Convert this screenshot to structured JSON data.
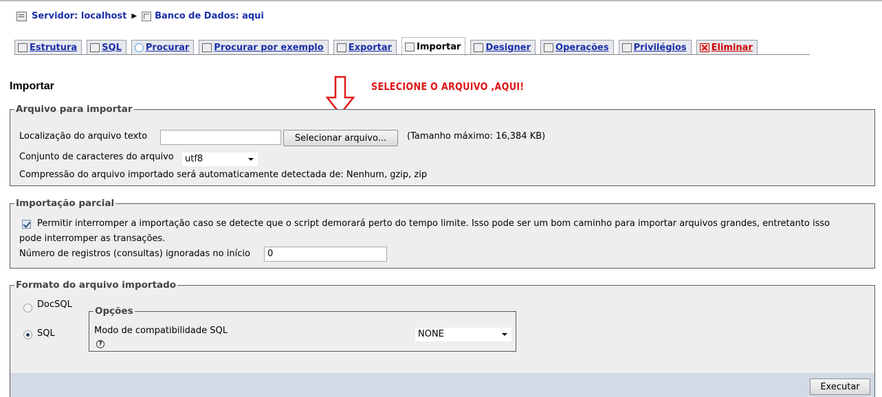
{
  "breadcrumb": {
    "server": "Servidor: localhost",
    "database": "Banco de Dados: aqui"
  },
  "tabs": [
    {
      "label": "Estrutura",
      "icon": "structure-icon"
    },
    {
      "label": "SQL",
      "icon": "sql-icon"
    },
    {
      "label": "Procurar",
      "icon": "search-icon"
    },
    {
      "label": "Procurar por exemplo",
      "icon": "query-icon"
    },
    {
      "label": "Exportar",
      "icon": "export-icon"
    },
    {
      "label": "Importar",
      "icon": "import-icon"
    },
    {
      "label": "Designer",
      "icon": "designer-icon"
    },
    {
      "label": "Operações",
      "icon": "operations-icon"
    },
    {
      "label": "Privilégios",
      "icon": "privileges-icon"
    },
    {
      "label": "Eliminar",
      "icon": "delete-icon"
    }
  ],
  "page_title": "Importar",
  "annotation": "SELECIONE O ARQUIVO ,AQUI!",
  "file_section": {
    "legend": "Arquivo para importar",
    "location_label": "Localização do arquivo texto",
    "file_value": "",
    "choose_button": "Selecionar arquivo...",
    "max_size": "(Tamanho máximo: 16,384 KB)",
    "charset_label": "Conjunto de caracteres do arquivo",
    "charset_value": "utf8",
    "compression_text": "Compressão do arquivo importado será automaticamente detectada de: Nenhum, gzip, zip"
  },
  "partial_section": {
    "legend": "Importação parcial",
    "allow_interrupt_line1": "Permitir interromper a importação caso se detecte que o script demorará perto do tempo limite. Isso pode ser um bom caminho para importar arquivos grandes, entretanto isso",
    "allow_interrupt_line2": "pode interromper as transações.",
    "allow_interrupt_checked": true,
    "skip_label": "Número de registros (consultas) ignoradas no início",
    "skip_value": "0"
  },
  "format_section": {
    "legend": "Formato do arquivo importado",
    "formats": [
      {
        "label": "DocSQL",
        "selected": false
      },
      {
        "label": "SQL",
        "selected": true
      }
    ],
    "options_legend": "Opções",
    "compat_label": "Modo de compatibilidade SQL",
    "compat_value": "NONE",
    "help_glyph": "?"
  },
  "execute_button": "Executar",
  "colors": {
    "link": "#1b2fa8",
    "danger": "#cc0000",
    "annotation": "#e01818",
    "fieldset_bg": "#eeeeee",
    "footer_bg": "#d3dae5"
  }
}
